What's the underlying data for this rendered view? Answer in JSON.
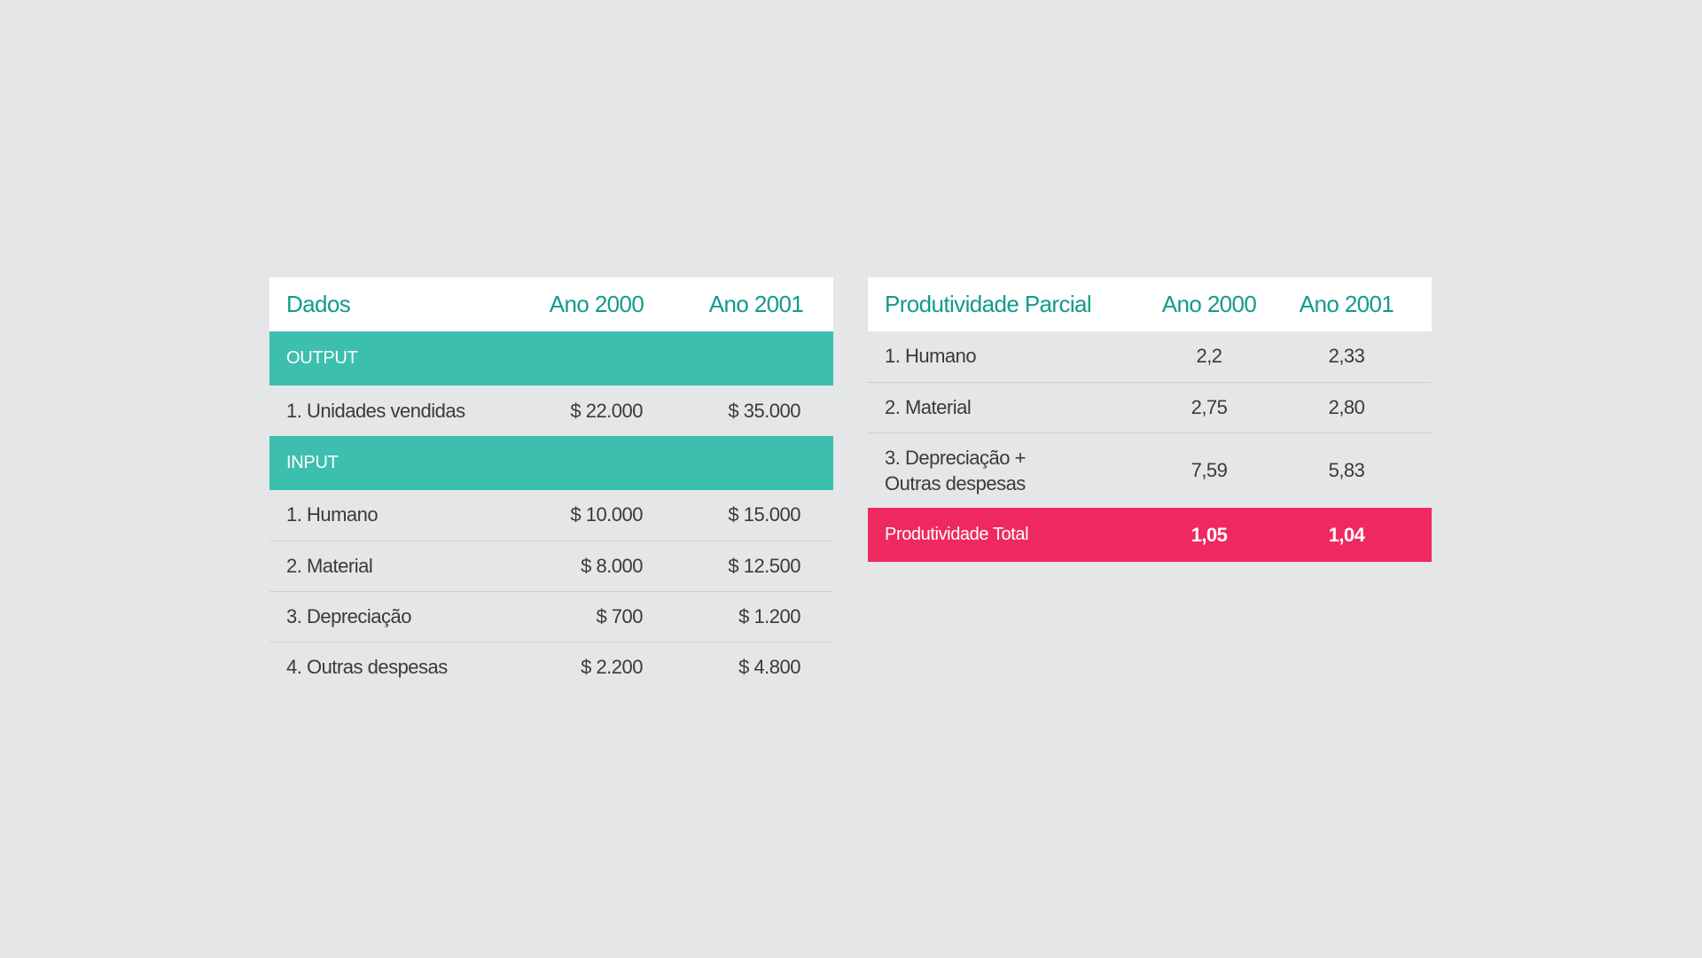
{
  "dados_table": {
    "headers": [
      "Dados",
      "Ano 2000",
      "Ano 2001"
    ],
    "output_label": "OUTPUT",
    "output_rows": [
      {
        "label": "1. Unidades vendidas",
        "y2000": "$ 22.000",
        "y2001": "$ 35.000"
      }
    ],
    "input_label": "INPUT",
    "input_rows": [
      {
        "label": "1. Humano",
        "y2000": "$ 10.000",
        "y2001": "$ 15.000"
      },
      {
        "label": "2. Material",
        "y2000": "$ 8.000",
        "y2001": "$ 12.500"
      },
      {
        "label": "3. Depreciação",
        "y2000": "$ 700",
        "y2001": "$ 1.200"
      },
      {
        "label": "4. Outras despesas",
        "y2000": "$ 2.200",
        "y2001": "$ 4.800"
      }
    ]
  },
  "produtividade_table": {
    "headers": [
      "Produtividade Parcial",
      "Ano 2000",
      "Ano 2001"
    ],
    "rows": [
      {
        "label": "1. Humano",
        "y2000": "2,2",
        "y2001": "2,33"
      },
      {
        "label": "2. Material",
        "y2000": "2,75",
        "y2001": "2,80"
      },
      {
        "label_line1": "3. Depreciação +",
        "label_line2": "Outras despesas",
        "y2000": "7,59",
        "y2001": "5,83"
      }
    ],
    "total": {
      "label": "Produtividade Total",
      "y2000": "1,05",
      "y2001": "1,04"
    }
  },
  "colors": {
    "background": "#e4e6e8",
    "header_text": "#119b8a",
    "section_band": "#3cbfae",
    "total_band": "#ef2960",
    "body_text": "#3a3a3c"
  }
}
